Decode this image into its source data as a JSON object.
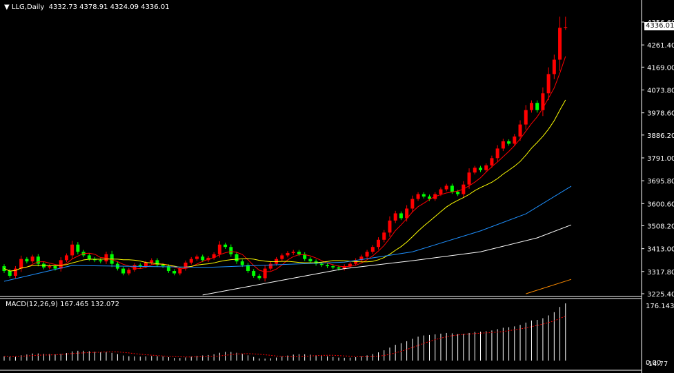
{
  "header": {
    "symbol": "LLG,Daily",
    "ohlc": "4332.73 4378.91 4324.09 4336.01"
  },
  "macd_header": {
    "label": "MACD(12,26,9)",
    "values": "167.465 132.072"
  },
  "current_price": "4336.01",
  "colors": {
    "up": "#ff0000",
    "down": "#00ff00",
    "ma_fast": "#ff0000",
    "ma_mid": "#ffff00",
    "ma_blue": "#1e90ff",
    "ma_white": "#ffffff",
    "ma_orange": "#ff8c00",
    "grid": "#ffffff"
  },
  "chart_data": [
    {
      "type": "candlestick",
      "title": "LLG,Daily",
      "yticks": [
        "4356.60",
        "4261.40",
        "4169.00",
        "4073.80",
        "3978.60",
        "3886.20",
        "3791.00",
        "3695.80",
        "3600.60",
        "3508.20",
        "3413.00",
        "3317.80",
        "3225.40"
      ],
      "ylim": [
        3225.4,
        4356.6
      ],
      "last": {
        "open": 4332.73,
        "high": 4378.91,
        "low": 4324.09,
        "close": 4336.01
      },
      "close": [
        3340,
        3320,
        3300,
        3330,
        3370,
        3360,
        3380,
        3350,
        3335,
        3340,
        3330,
        3365,
        3385,
        3430,
        3400,
        3385,
        3370,
        3365,
        3360,
        3390,
        3350,
        3330,
        3310,
        3325,
        3345,
        3340,
        3355,
        3365,
        3345,
        3340,
        3320,
        3310,
        3330,
        3355,
        3370,
        3380,
        3365,
        3375,
        3390,
        3430,
        3420,
        3390,
        3360,
        3345,
        3320,
        3300,
        3290,
        3330,
        3350,
        3370,
        3385,
        3395,
        3400,
        3390,
        3370,
        3360,
        3350,
        3345,
        3340,
        3335,
        3330,
        3340,
        3350,
        3365,
        3380,
        3400,
        3420,
        3450,
        3480,
        3530,
        3560,
        3540,
        3580,
        3620,
        3640,
        3630,
        3620,
        3640,
        3660,
        3675,
        3650,
        3640,
        3680,
        3730,
        3750,
        3740,
        3760,
        3790,
        3830,
        3860,
        3850,
        3880,
        3930,
        3990,
        4020,
        3990,
        4060,
        4140,
        4200,
        4332.73,
        4336.01
      ],
      "ma_blue": [
        [
          0,
          3277
        ],
        [
          12,
          3343
        ],
        [
          36,
          3335
        ],
        [
          60,
          3357
        ],
        [
          72,
          3400
        ],
        [
          84,
          3487
        ],
        [
          92,
          3558
        ],
        [
          100,
          3673
        ]
      ],
      "ma_white": [
        [
          35,
          3220
        ],
        [
          48,
          3277
        ],
        [
          60,
          3330
        ],
        [
          72,
          3363
        ],
        [
          84,
          3400
        ],
        [
          94,
          3458
        ],
        [
          100,
          3512
        ]
      ],
      "ma_orange": [
        [
          92,
          3225
        ],
        [
          100,
          3285
        ]
      ]
    },
    {
      "type": "histogram",
      "title": "MACD(12,26,9)",
      "yticks": [
        "176.143",
        "0.00",
        "-14.77"
      ],
      "ylim": [
        -14.77,
        176.143
      ]
    }
  ]
}
